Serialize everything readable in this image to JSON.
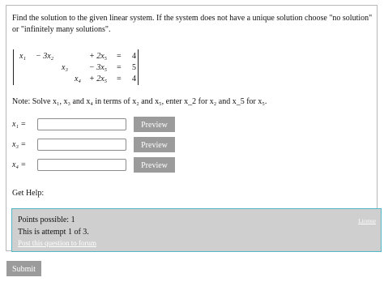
{
  "question": {
    "prompt": "Find the solution to the given linear system. If the system does not have a unique solution choose \"no solution\" or \"infinitely many solutions\".",
    "system": {
      "row1": {
        "t1": "x₁",
        "t2": "− 3x₂",
        "t3": "+ 2x₅",
        "eq": "=",
        "rhs": "4"
      },
      "row2": {
        "t1": "x₃",
        "t2": "− 3x₅",
        "eq": "=",
        "rhs": "5"
      },
      "row3": {
        "t1": "x₄",
        "t2": "+ 2x₅",
        "eq": "=",
        "rhs": "4"
      }
    },
    "note": "Note: Solve x₁, x₃ and x₄ in terms of x₂ and x₅, enter x_2 for x₂ and x_5 for x₅."
  },
  "answers": [
    {
      "label": "x₁ =",
      "value": "",
      "preview_label": "Preview"
    },
    {
      "label": "x₃ =",
      "value": "",
      "preview_label": "Preview"
    },
    {
      "label": "x₄ =",
      "value": "",
      "preview_label": "Preview"
    }
  ],
  "help": {
    "label": "Get Help:"
  },
  "info": {
    "points": "Points possible: 1",
    "attempt": "This is attempt 1 of 3.",
    "forum_link": "Post this question to forum",
    "license_link": "License"
  },
  "submit_label": "Submit"
}
